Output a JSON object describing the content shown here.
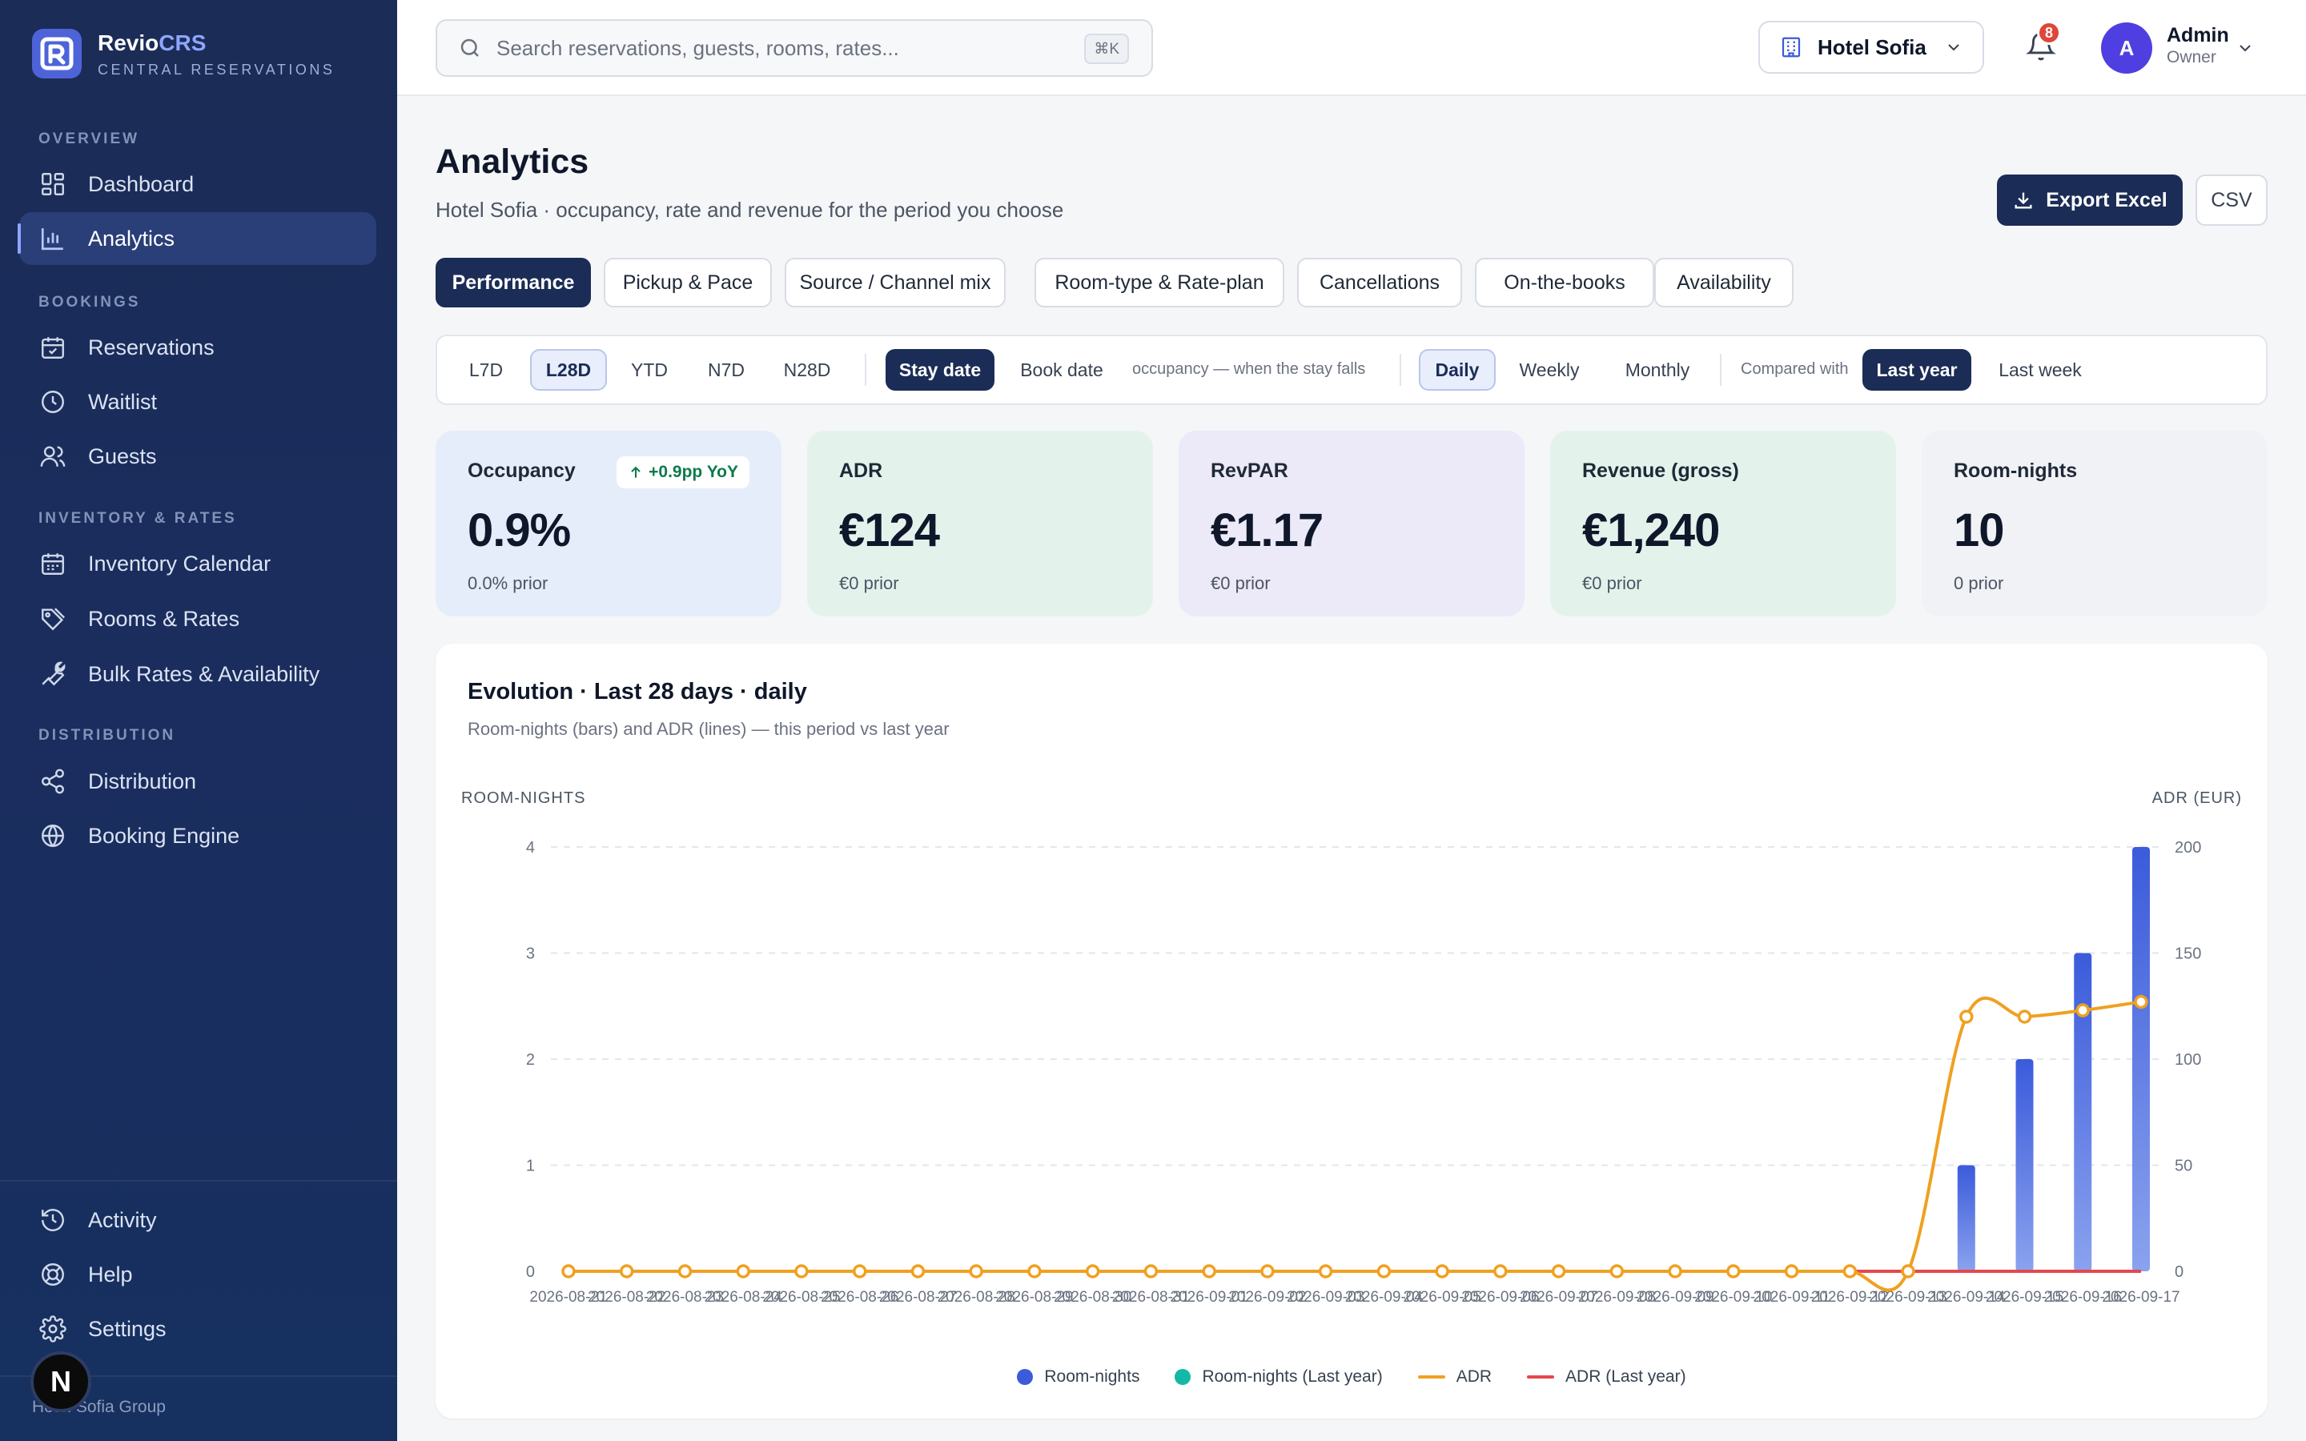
{
  "brand": {
    "name_a": "Revio",
    "name_b": "CRS",
    "sub": "CENTRAL RESERVATIONS"
  },
  "sidebar": {
    "sections": [
      "OVERVIEW",
      "BOOKINGS",
      "INVENTORY & RATES",
      "DISTRIBUTION"
    ],
    "items": [
      {
        "label": "Dashboard",
        "icon": "dashboard-icon"
      },
      {
        "label": "Analytics",
        "icon": "analytics-icon",
        "active": true
      },
      {
        "label": "Reservations",
        "icon": "calendar-check-icon"
      },
      {
        "label": "Waitlist",
        "icon": "clock-icon"
      },
      {
        "label": "Guests",
        "icon": "users-icon"
      },
      {
        "label": "Inventory Calendar",
        "icon": "calendar-icon"
      },
      {
        "label": "Rooms & Rates",
        "icon": "tags-icon"
      },
      {
        "label": "Bulk Rates & Availability",
        "icon": "wrench-icon"
      },
      {
        "label": "Distribution",
        "icon": "share-icon"
      },
      {
        "label": "Booking Engine",
        "icon": "globe-icon"
      }
    ],
    "footer_items": [
      {
        "label": "Activity",
        "icon": "history-icon"
      },
      {
        "label": "Help",
        "icon": "lifebuoy-icon"
      },
      {
        "label": "Settings",
        "icon": "gear-icon"
      }
    ],
    "org_initial": "N",
    "org_name": "Hotel Sofia Group"
  },
  "topbar": {
    "search_placeholder": "Search reservations, guests, rooms, rates...",
    "search_shortcut": "⌘K",
    "hotel": "Hotel Sofia",
    "notifications": "8",
    "user_initial": "A",
    "user_name": "Admin",
    "user_role": "Owner"
  },
  "page": {
    "title": "Analytics",
    "subtitle": "Hotel Sofia · occupancy, rate and revenue for the period you choose",
    "export_label": "Export Excel",
    "csv_label": "CSV"
  },
  "tabs": [
    "Performance",
    "Pickup & Pace",
    "Source / Channel mix",
    "Room-type & Rate-plan",
    "Cancellations",
    "On-the-books",
    "Availability"
  ],
  "filters": {
    "ranges": [
      "L7D",
      "L28D",
      "YTD",
      "N7D",
      "N28D"
    ],
    "range_selected": "L28D",
    "date_modes": [
      "Stay date",
      "Book date"
    ],
    "date_mode_selected": "Stay date",
    "date_note": "occupancy — when the stay falls",
    "grains": [
      "Daily",
      "Weekly",
      "Monthly"
    ],
    "grain_selected": "Daily",
    "compare_label": "Compared with",
    "compare": [
      "Last year",
      "Last week"
    ],
    "compare_selected": "Last year"
  },
  "kpis": [
    {
      "label": "Occupancy",
      "value": "0.9%",
      "prior": "0.0% prior",
      "delta": "+0.9pp YoY",
      "bg": "#e6edfa"
    },
    {
      "label": "ADR",
      "value": "€124",
      "prior": "€0 prior",
      "bg": "#e3f3ec"
    },
    {
      "label": "RevPAR",
      "value": "€1.17",
      "prior": "€0 prior",
      "bg": "#ece9f8"
    },
    {
      "label": "Revenue (gross)",
      "value": "€1,240",
      "prior": "€0 prior",
      "bg": "#e3f3ec"
    },
    {
      "label": "Room-nights",
      "value": "10",
      "prior": "0 prior",
      "bg": "#f1f2f5"
    }
  ],
  "chart": {
    "title": "Evolution · Last 28 days · daily",
    "subtitle": "Room-nights (bars) and ADR (lines) — this period vs last year",
    "left_axis_title": "ROOM-NIGHTS",
    "right_axis_title": "ADR (EUR)",
    "legend": [
      "Room-nights",
      "Room-nights (Last year)",
      "ADR",
      "ADR (Last year)"
    ]
  },
  "colors": {
    "room_nights": "#3b5bdb",
    "room_nights_ly": "#14b8a6",
    "adr": "#f0a020",
    "adr_ly": "#e5484d"
  },
  "chart_data": {
    "type": "bar",
    "title": "Evolution · Last 28 days · daily",
    "x": [
      "2026-08-21",
      "2026-08-22",
      "2026-08-23",
      "2026-08-24",
      "2026-08-25",
      "2026-08-26",
      "2026-08-27",
      "2026-08-28",
      "2026-08-29",
      "2026-08-30",
      "2026-08-31",
      "2026-09-01",
      "2026-09-02",
      "2026-09-03",
      "2026-09-04",
      "2026-09-05",
      "2026-09-06",
      "2026-09-07",
      "2026-09-08",
      "2026-09-09",
      "2026-09-10",
      "2026-09-11",
      "2026-09-12",
      "2026-09-13",
      "2026-09-14",
      "2026-09-15",
      "2026-09-16",
      "2026-09-17"
    ],
    "ylabel": "ROOM-NIGHTS",
    "y2label": "ADR (EUR)",
    "ylim": [
      0,
      4
    ],
    "y2lim": [
      0,
      200
    ],
    "yticks": [
      0,
      1,
      2,
      3,
      4
    ],
    "y2ticks": [
      0,
      50,
      100,
      150,
      200
    ],
    "series": [
      {
        "name": "Room-nights",
        "type": "bar",
        "axis": "left",
        "values": [
          0,
          0,
          0,
          0,
          0,
          0,
          0,
          0,
          0,
          0,
          0,
          0,
          0,
          0,
          0,
          0,
          0,
          0,
          0,
          0,
          0,
          0,
          0,
          0,
          1,
          2,
          3,
          4
        ]
      },
      {
        "name": "Room-nights (Last year)",
        "type": "bar",
        "axis": "left",
        "values": [
          0,
          0,
          0,
          0,
          0,
          0,
          0,
          0,
          0,
          0,
          0,
          0,
          0,
          0,
          0,
          0,
          0,
          0,
          0,
          0,
          0,
          0,
          0,
          0,
          0,
          0,
          0,
          0
        ]
      },
      {
        "name": "ADR",
        "type": "line",
        "axis": "right",
        "values": [
          0,
          0,
          0,
          0,
          0,
          0,
          0,
          0,
          0,
          0,
          0,
          0,
          0,
          0,
          0,
          0,
          0,
          0,
          0,
          0,
          0,
          0,
          0,
          0,
          120,
          120,
          123,
          127
        ]
      },
      {
        "name": "ADR (Last year)",
        "type": "line",
        "axis": "right",
        "values": [
          0,
          0,
          0,
          0,
          0,
          0,
          0,
          0,
          0,
          0,
          0,
          0,
          0,
          0,
          0,
          0,
          0,
          0,
          0,
          0,
          0,
          0,
          0,
          0,
          0,
          0,
          0,
          0
        ]
      }
    ],
    "legend_position": "bottom",
    "grid": true
  }
}
